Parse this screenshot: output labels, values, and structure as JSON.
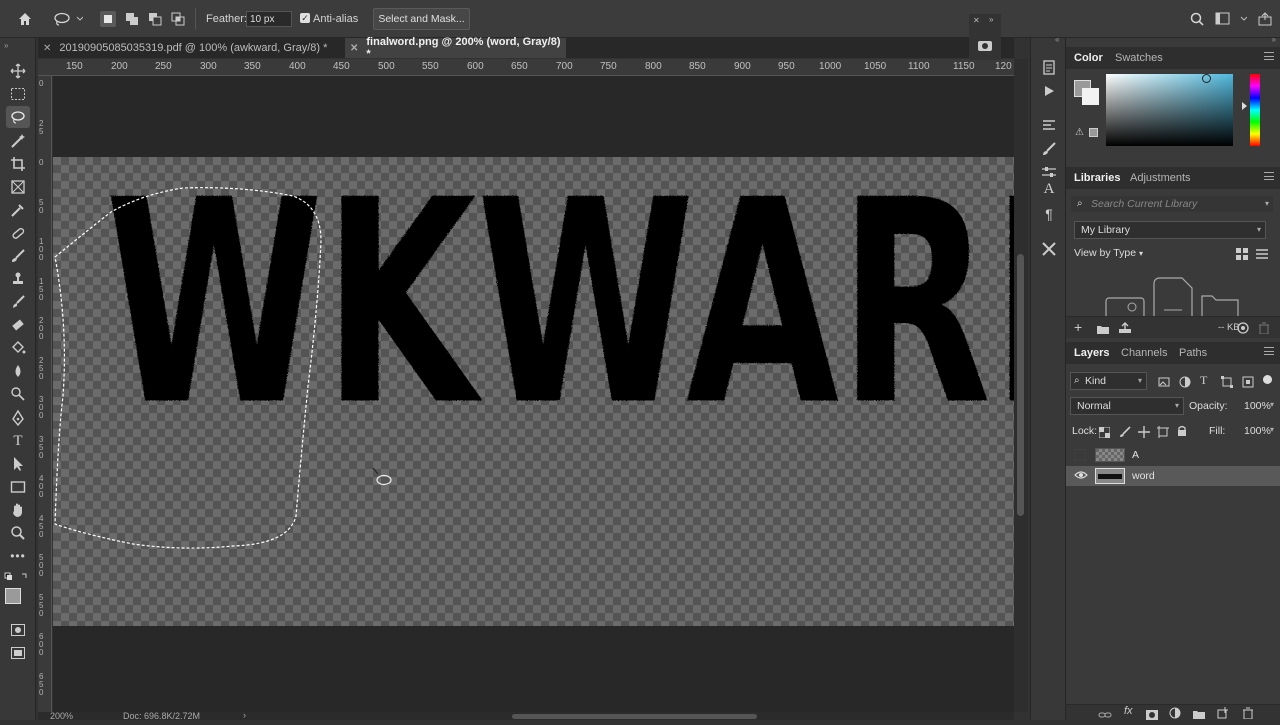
{
  "options_bar": {
    "feather_label": "Feather:",
    "feather_value": "10 px",
    "anti_alias_label": "Anti-alias",
    "anti_alias_checked": true,
    "select_mask_label": "Select and Mask..."
  },
  "tabs": [
    {
      "label": "20190905085035319.pdf @ 100% (awkward, Gray/8) *",
      "active": false
    },
    {
      "label": "finalword.png @ 200% (word, Gray/8) *",
      "active": true
    }
  ],
  "ruler_top": [
    "150",
    "200",
    "250",
    "300",
    "350",
    "400",
    "450",
    "500",
    "550",
    "600",
    "650",
    "700",
    "750",
    "800",
    "850",
    "900",
    "950",
    "1000",
    "1050",
    "1100",
    "1150",
    "120"
  ],
  "ruler_left": [
    [
      "0"
    ],
    [
      "2",
      "5"
    ],
    [
      "0"
    ],
    [
      "5",
      "0"
    ],
    [
      "1",
      "0",
      "0"
    ],
    [
      "1",
      "5",
      "0"
    ],
    [
      "2",
      "0",
      "0"
    ],
    [
      "2",
      "5",
      "0"
    ],
    [
      "3",
      "0",
      "0"
    ],
    [
      "3",
      "5",
      "0"
    ],
    [
      "4",
      "0",
      "0"
    ],
    [
      "4",
      "5",
      "0"
    ],
    [
      "5",
      "0",
      "0"
    ],
    [
      "5",
      "5",
      "0"
    ],
    [
      "6",
      "0",
      "0"
    ],
    [
      "6",
      "5",
      "0"
    ]
  ],
  "canvas": {
    "text": "WKWARI"
  },
  "status": {
    "zoom": "200%",
    "doc": "Doc: 696.8K/2.72M",
    "arrow": "›"
  },
  "color_panel": {
    "tabs": [
      "Color",
      "Swatches"
    ],
    "hue_accent": "#4fb8dc"
  },
  "libraries_panel": {
    "tabs": [
      "Libraries",
      "Adjustments"
    ],
    "search_placeholder": "Search Current Library",
    "library_name": "My Library",
    "view_by": "View by Type",
    "size": "-- KB"
  },
  "layers_panel": {
    "tabs": [
      "Layers",
      "Channels",
      "Paths"
    ],
    "filter_kind": "Kind",
    "blend_mode": "Normal",
    "opacity_label": "Opacity:",
    "opacity_value": "100%",
    "lock_label": "Lock:",
    "fill_label": "Fill:",
    "fill_value": "100%",
    "layers": [
      {
        "name": "A",
        "visible": false,
        "selected": false
      },
      {
        "name": "word",
        "visible": true,
        "selected": true
      }
    ]
  }
}
